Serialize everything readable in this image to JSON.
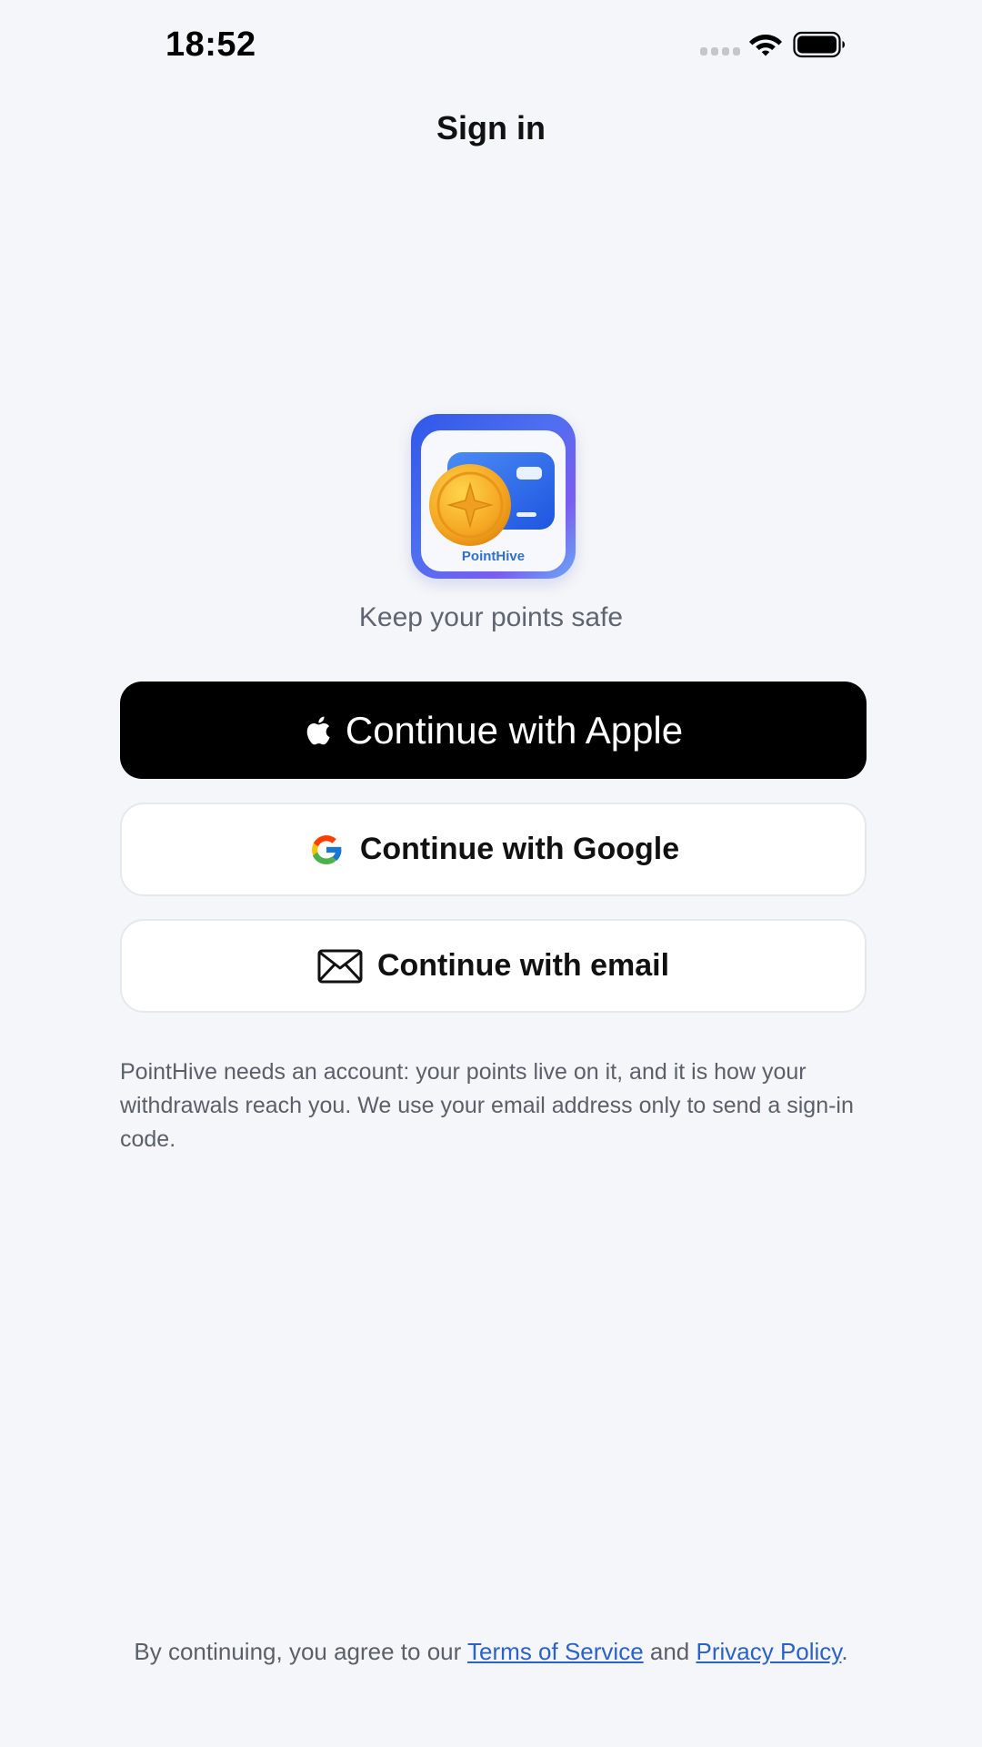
{
  "status_bar": {
    "time": "18:52"
  },
  "nav": {
    "title": "Sign in"
  },
  "app": {
    "icon_label": "PointHive",
    "tagline": "Keep your points safe"
  },
  "buttons": {
    "apple": "Continue with Apple",
    "google": "Continue with Google",
    "email": "Continue with email"
  },
  "info_text": "PointHive needs an account: your points live on it, and it is how your withdrawals reach you. We use your email address only to send a sign-in code.",
  "legal": {
    "prefix": "By continuing, you agree to our ",
    "terms": "Terms of Service",
    "middle": " and ",
    "privacy": "Privacy Policy",
    "suffix": "."
  },
  "colors": {
    "background": "#f5f6f9",
    "apple_button": "#000000",
    "link": "#2a62c9",
    "secondary_text": "#5a5f69"
  },
  "icons": [
    "wifi-icon",
    "battery-icon",
    "apple-icon",
    "google-icon",
    "mail-icon",
    "app-logo"
  ]
}
